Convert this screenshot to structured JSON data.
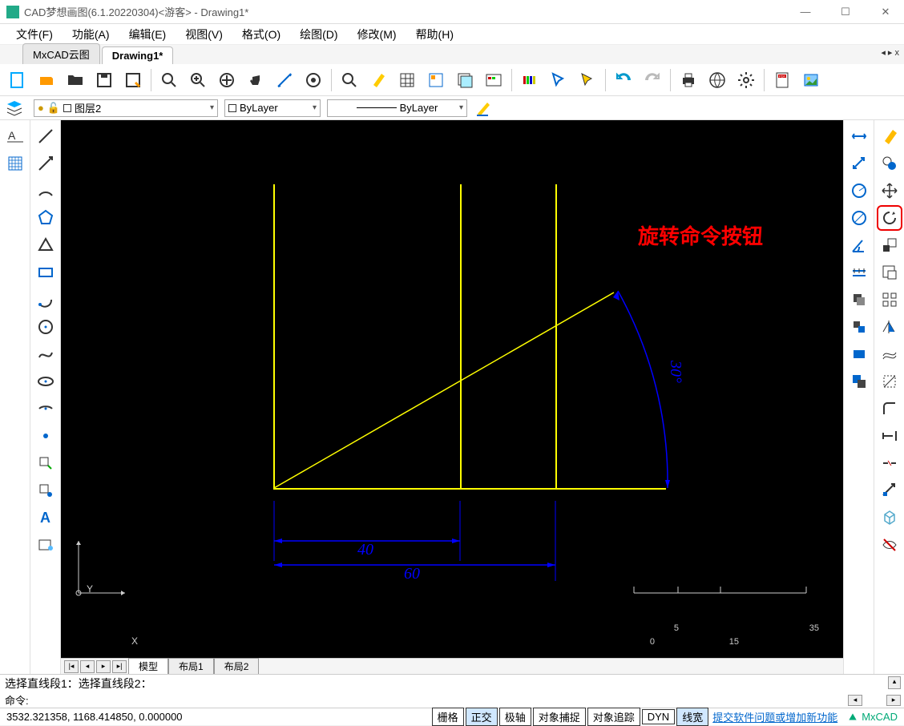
{
  "title": "CAD梦想画图(6.1.20220304)<游客> - Drawing1*",
  "menus": [
    "文件(F)",
    "功能(A)",
    "编辑(E)",
    "视图(V)",
    "格式(O)",
    "绘图(D)",
    "修改(M)",
    "帮助(H)"
  ],
  "tabs": {
    "items": [
      "MxCAD云图",
      "Drawing1*"
    ],
    "active": 1
  },
  "layer": {
    "current": "图层2",
    "color": "ByLayer",
    "linetype": "ByLayer"
  },
  "annotation": "旋转命令按钮",
  "dims": {
    "d40": "40",
    "d60": "60",
    "ang30": "30°"
  },
  "ruler": {
    "t1": "5",
    "t2": "35",
    "t3": "0",
    "t4": "15"
  },
  "axes": {
    "x": "X",
    "y": "Y"
  },
  "dwgtabs": {
    "items": [
      "模型",
      "布局1",
      "布局2"
    ],
    "active": 0
  },
  "cmd": {
    "history": "选择直线段1：选择直线段2：",
    "prompt": "命令:"
  },
  "status": {
    "coords": "3532.321358, 1168.414850, 0.000000",
    "modes": [
      "栅格",
      "正交",
      "极轴",
      "对象捕捉",
      "对象追踪",
      "DYN",
      "线宽"
    ],
    "active_modes": [
      1,
      6
    ],
    "link": "提交软件问题或增加新功能",
    "brand": "MxCAD"
  }
}
